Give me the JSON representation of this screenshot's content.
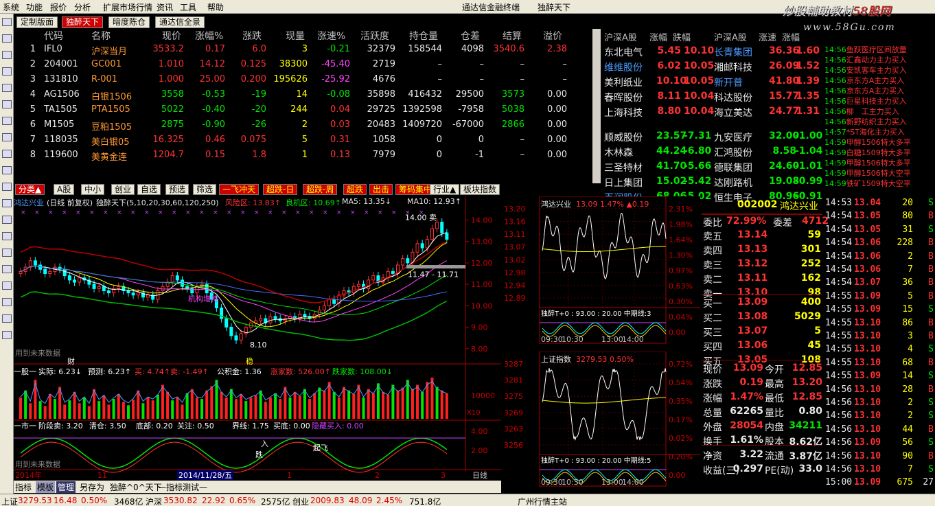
{
  "menu": [
    "系统",
    "功能",
    "报价",
    "分析",
    "扩展市场行情",
    "资讯",
    "工具",
    "帮助"
  ],
  "window_title": "通达信金融终端",
  "window_subtitle": "独醉天下",
  "watermark": {
    "a": "炒股輔助教材",
    "b": "58股网",
    "c": "www.58Gu.com"
  },
  "top_tabs": [
    "定制版面",
    "独醉天下",
    "暗度陈仓",
    "通达信全景"
  ],
  "quote_headers": [
    "代码",
    "名称",
    "现价",
    "涨幅%",
    "涨跌",
    "现量",
    "涨速%",
    "活跃度",
    "持仓量",
    "仓差",
    "结算",
    "溢价"
  ],
  "quote_rows": [
    {
      "n": "1",
      "code": "IFL0",
      "name": "沪深当月",
      "price": "3533.2",
      "pct": "0.17",
      "chg": "6.0",
      "vol": "3",
      "spd": "-0.21",
      "act": "32379",
      "oi": "158544",
      "doi": "4098",
      "set": "3540.6",
      "prem": "2.38"
    },
    {
      "n": "2",
      "code": "204001",
      "name": "GC001",
      "price": "1.010",
      "pct": "14.12",
      "chg": "0.125",
      "vol": "38300",
      "spd": "-45.40",
      "act": "2719",
      "oi": "–",
      "doi": "–",
      "set": "–",
      "prem": "–"
    },
    {
      "n": "3",
      "code": "131810",
      "name": "R-001",
      "price": "1.000",
      "pct": "25.00",
      "chg": "0.200",
      "vol": "195626",
      "spd": "-25.92",
      "act": "4676",
      "oi": "–",
      "doi": "–",
      "set": "–",
      "prem": "–"
    },
    {
      "n": "4",
      "code": "AG1506",
      "name": "白银1506",
      "price": "3558",
      "pct": "-0.53",
      "chg": "-19",
      "vol": "14",
      "spd": "-0.08",
      "act": "35898",
      "oi": "416432",
      "doi": "29500",
      "set": "3573",
      "prem": "0.00"
    },
    {
      "n": "5",
      "code": "TA1505",
      "name": "PTA1505",
      "price": "5022",
      "pct": "-0.40",
      "chg": "-20",
      "vol": "244",
      "spd": "0.04",
      "act": "29725",
      "oi": "1392598",
      "doi": "-7958",
      "set": "5038",
      "prem": "0.00"
    },
    {
      "n": "6",
      "code": "M1505",
      "name": "豆粕1505",
      "price": "2875",
      "pct": "-0.90",
      "chg": "-26",
      "vol": "2",
      "spd": "0.03",
      "act": "20483",
      "oi": "1409720",
      "doi": "-67000",
      "set": "2866",
      "prem": "0.00"
    },
    {
      "n": "7",
      "code": "118035",
      "name": "美白银05",
      "price": "16.325",
      "pct": "0.46",
      "chg": "0.075",
      "vol": "5",
      "spd": "0.31",
      "act": "1058",
      "oi": "0",
      "doi": "0",
      "set": "–",
      "prem": "0.00"
    },
    {
      "n": "8",
      "code": "119600",
      "name": "美黄金连",
      "price": "1204.7",
      "pct": "0.15",
      "chg": "1.8",
      "vol": "1",
      "spd": "0.13",
      "act": "7979",
      "oi": "0",
      "doi": "-1",
      "set": "–",
      "prem": "0.00"
    }
  ],
  "rank": {
    "h1": "沪深A股",
    "h2": "涨幅",
    "h3": "跌幅",
    "h4": "沪深A股",
    "h5": "涨速",
    "h6": "涨幅",
    "left": [
      [
        "东北电气",
        "5.45",
        "10.10"
      ],
      [
        "维维股份",
        "6.02",
        "10.05"
      ],
      [
        "美利纸业",
        "10.10",
        "10.05"
      ],
      [
        "春晖股份",
        "8.11",
        "10.04"
      ],
      [
        "上海科技",
        "8.80",
        "10.04"
      ],
      [
        "顺威股份",
        "23.57",
        "-7.31"
      ],
      [
        "木林森",
        "44.24",
        "-6.80"
      ],
      [
        "三圣特材",
        "41.70",
        "-5.66"
      ],
      [
        "日上集团",
        "15.02",
        "-5.42"
      ],
      [
        "百润股份",
        "68.06",
        "-5.02"
      ]
    ],
    "right": [
      [
        "长青集团",
        "36.36",
        "1.60"
      ],
      [
        "湘邮科技",
        "26.09",
        "1.52"
      ],
      [
        "新开普",
        "41.80",
        "1.39"
      ],
      [
        "科达股份",
        "15.77",
        "1.35"
      ],
      [
        "海立美达",
        "24.77",
        "1.31"
      ],
      [
        "九安医疗",
        "32.00",
        "-1.00"
      ],
      [
        "汇鸿股份",
        "8.58",
        "-1.04"
      ],
      [
        "德联集团",
        "24.60",
        "-1.01"
      ],
      [
        "达刚路机",
        "19.08",
        "-0.99"
      ],
      [
        "恒生电子",
        "80.96",
        "-0.91"
      ]
    ]
  },
  "ticker": [
    [
      "14:56",
      "鱼跃医疗",
      "区间放量"
    ],
    [
      "14:56",
      "汇鑫动力",
      "主力买入"
    ],
    [
      "14:56",
      "安凯客车",
      "主力买入"
    ],
    [
      "14:56",
      "京东方A",
      "主力买入"
    ],
    [
      "14:56",
      "京东方A",
      "主力买入"
    ],
    [
      "14:56",
      "巨星科技",
      "主力买入"
    ],
    [
      "14:56",
      "柳　工",
      "主力买入"
    ],
    [
      "14:56",
      "新野纺织",
      "主力买入"
    ],
    [
      "14:57",
      "*ST海化",
      "主力买入"
    ],
    [
      "14:59",
      "甲醇1506",
      "特大多平"
    ],
    [
      "14:59",
      "白糖1509",
      "特大多平"
    ],
    [
      "14:59",
      "甲醇1506",
      "特大多平"
    ],
    [
      "14:59",
      "甲醇1506",
      "特大空平"
    ],
    [
      "14:59",
      "铁矿1509",
      "特大空平"
    ]
  ],
  "categories": [
    "分类▲",
    "A股",
    "中小",
    "创业",
    "自选",
    "预选",
    "筛选",
    "一飞冲天",
    "超跌-日",
    "超跌-周",
    "超跌",
    "出击",
    "筹码集中",
    "行业▲",
    "板块指数"
  ],
  "kline_info": {
    "name": "鸿达兴业",
    "period": "(日线 前复权)",
    "formula": "独醉天下(5,10,20,30,60,120,250)",
    "risk": "风险区: 13.83↑",
    "good": "良机区: 10.69↑",
    "ma5": "MA5: 13.35↓",
    "ma10": "MA10: 12.93↑",
    "top_price": "14.00 卖",
    "range": "11.47 - 11.71",
    "low": "8.10",
    "tags": [
      "用到未来数据",
      "财",
      "稳",
      "机构增持"
    ]
  },
  "kline_yaxis": [
    "14.00",
    "13.00",
    "12.00",
    "11.00",
    "10.00",
    "9.00",
    "8.00"
  ],
  "vol_info": {
    "label": "一股一",
    "real": "实际: 6.23↓",
    "pred": "预测: 6.23↑",
    "buy": "买: 4.74↑",
    "sell": "卖: -1.49↑",
    "fund": "公积金: 1.36",
    "zhang": "涨家数: 526.00↑",
    "die": "跌家数: 108.00↓"
  },
  "vol_yaxis": [
    "10000",
    "X10"
  ],
  "ind_info": {
    "label": "一市一",
    "stage": "阶段卖: 3.20",
    "clear": "清仓: 3.50",
    "bottom": "底部: 0.20",
    "focus": "关注: 0.50",
    "line": "界线: 1.75",
    "buy": "买底: 0.00",
    "extra": "隐藏买入: 0.00",
    "tag1": "入",
    "tag2": "跌",
    "tag3": "起飞",
    "tag4": "用到未来数据"
  },
  "ind_yaxis": [
    "4.00",
    "2.00"
  ],
  "date_axis": [
    "2014年",
    "11",
    "2014/11/28/五",
    "1",
    "2",
    "3",
    "日线"
  ],
  "m1": {
    "name": "鸿达兴业",
    "price": "13.09",
    "pct": "1.47%",
    "chg": "▲0.19",
    "y": [
      "13.20",
      "13.16",
      "13.11",
      "13.07",
      "13.02",
      "12.98",
      "12.94",
      "12.89"
    ],
    "p": [
      "2.31%",
      "1.98%",
      "1.64%",
      "1.30%",
      "0.97%",
      "0.63%",
      "0.30%",
      "0.04%",
      "0.00"
    ],
    "sub": "独醉T+0 : 93.00 : 20.00  中期线:3",
    "times": [
      "09:30",
      "10:30",
      "13:00",
      "14:00"
    ]
  },
  "m2": {
    "name": "上证指数",
    "price": "3279.53",
    "pct": "0.50%",
    "y": [
      "3287",
      "3281",
      "3275",
      "3269",
      "3263",
      "3256"
    ],
    "p": [
      "0.72%",
      "0.54%",
      "0.35%",
      "0.17%",
      "0.02%",
      "0.20%",
      "0.00"
    ],
    "sub": "独醉T+0 : 93.00 : 20.00  中期线:5",
    "times": [
      "09:30",
      "10:30",
      "13:00",
      "14:00"
    ]
  },
  "ob": {
    "code": "002002",
    "name": "鸿达兴业",
    "wb": "委比",
    "wbv": "72.99%",
    "wc": "委差",
    "wcv": "4712",
    "asks": [
      [
        "卖五",
        "13.14",
        "59"
      ],
      [
        "卖四",
        "13.13",
        "301"
      ],
      [
        "卖三",
        "13.12",
        "252"
      ],
      [
        "卖二",
        "13.11",
        "162"
      ],
      [
        "卖一",
        "13.10",
        "98"
      ]
    ],
    "bids": [
      [
        "买一",
        "13.09",
        "400"
      ],
      [
        "买二",
        "13.08",
        "5029"
      ],
      [
        "买三",
        "13.07",
        "5"
      ],
      [
        "买四",
        "13.06",
        "45"
      ],
      [
        "买五",
        "13.05",
        "108"
      ]
    ],
    "stats": [
      [
        "现价",
        "13.09",
        "今开",
        "12.85"
      ],
      [
        "涨跌",
        "0.19",
        "最高",
        "13.20"
      ],
      [
        "涨幅",
        "1.47%",
        "最低",
        "12.85"
      ],
      [
        "总量",
        "62265",
        "量比",
        "0.80"
      ],
      [
        "外盘",
        "28054",
        "内盘",
        "34211"
      ],
      [
        "换手",
        "1.61%",
        "股本",
        "8.62亿"
      ],
      [
        "净资",
        "3.22",
        "流通",
        "3.87亿"
      ],
      [
        "收益(三)",
        "0.297",
        "PE(动)",
        "33.0"
      ]
    ]
  },
  "ticks": [
    [
      "14:53",
      "13.04",
      "20",
      "S"
    ],
    [
      "14:54",
      "13.05",
      "80",
      "B"
    ],
    [
      "14:54",
      "13.05",
      "31",
      "S"
    ],
    [
      "14:54",
      "13.06",
      "228",
      "B"
    ],
    [
      "14:54",
      "13.06",
      "2",
      "B"
    ],
    [
      "14:54",
      "13.06",
      "7",
      "B"
    ],
    [
      "14:54",
      "13.07",
      "36",
      "B"
    ],
    [
      "14:55",
      "13.09",
      "5",
      "B"
    ],
    [
      "14:55",
      "13.09",
      "15",
      "S"
    ],
    [
      "14:55",
      "13.10",
      "86",
      "B"
    ],
    [
      "14:55",
      "13.10",
      "3",
      "B"
    ],
    [
      "14:55",
      "13.10",
      "4",
      "S"
    ],
    [
      "14:55",
      "13.10",
      "68",
      "B"
    ],
    [
      "14:55",
      "13.09",
      "14",
      "S"
    ],
    [
      "14:56",
      "13.10",
      "28",
      "B"
    ],
    [
      "14:56",
      "13.10",
      "2",
      "S"
    ],
    [
      "14:56",
      "13.10",
      "2",
      "S"
    ],
    [
      "14:56",
      "13.10",
      "44",
      "B"
    ],
    [
      "14:56",
      "13.09",
      "56",
      "S"
    ],
    [
      "14:56",
      "13.10",
      "90",
      "B"
    ],
    [
      "14:56",
      "13.10",
      "7",
      "S"
    ],
    [
      "15:00",
      "13.09",
      "675",
      "27"
    ]
  ],
  "bottom_tabs": [
    "指标",
    "模板",
    "管理",
    "另存为",
    "独醉^0^天下",
    "—指标测试—"
  ],
  "status": {
    "sh": "上证",
    "sh_v": "3279.53",
    "sh_c": "16.48",
    "sh_p": "0.50%",
    "sh_a": "3468亿",
    "hs": "沪深",
    "hs_v": "3530.82",
    "hs_c": "22.92",
    "hs_p": "0.65%",
    "hs_a": "2575亿",
    "cy": "创业",
    "cy_v": "2009.83",
    "cy_c": "48.09",
    "cy_p": "2.45%",
    "cy_a": "751.8亿",
    "site": "广州行情主站"
  },
  "colors": {
    "up": "#ff3232",
    "down": "#00e600",
    "accent": "#c00000",
    "bg": "#000000"
  }
}
